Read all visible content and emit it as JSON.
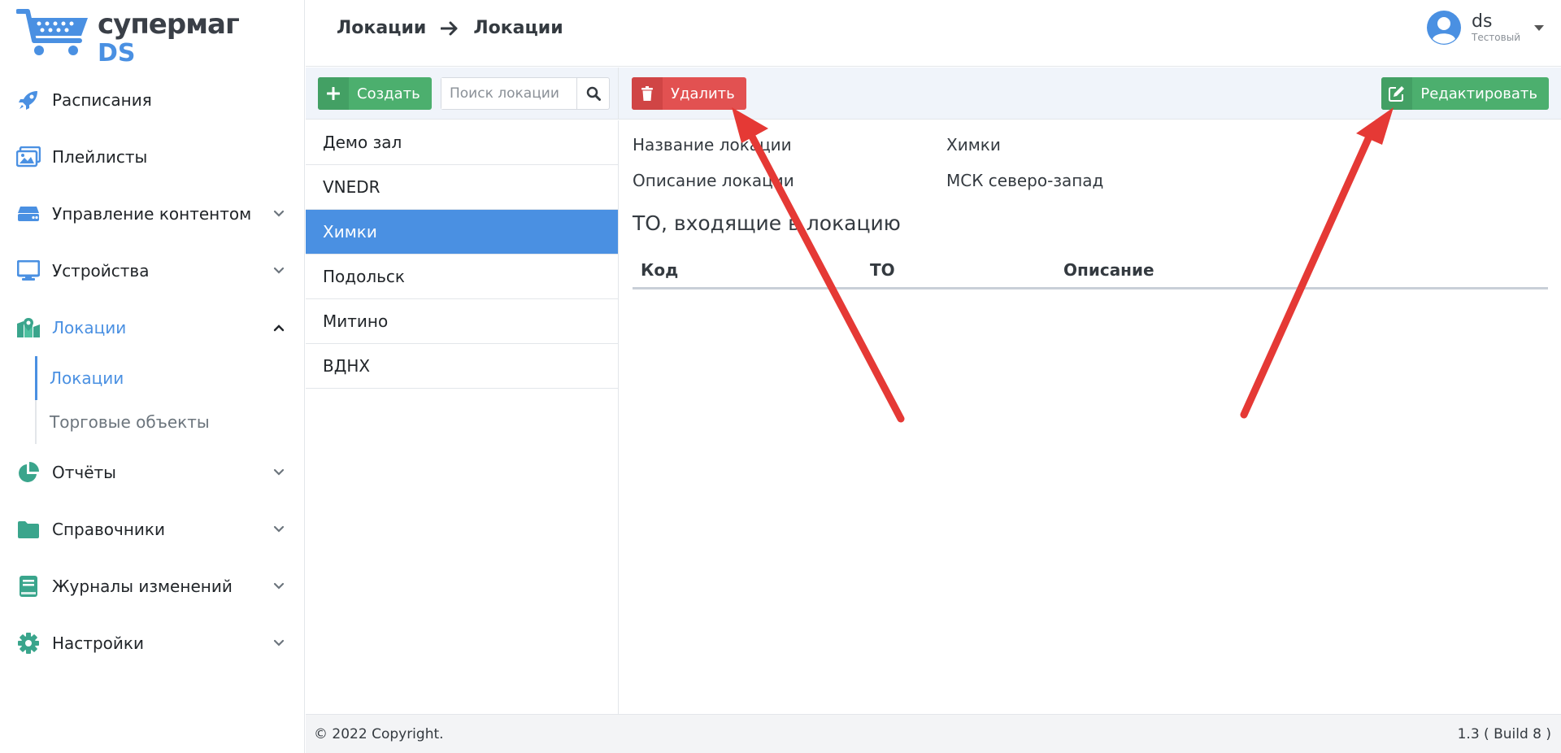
{
  "brand": {
    "line1": "супермаг",
    "line2": "DS"
  },
  "sidebar": {
    "items": [
      {
        "label": "Расписания",
        "icon": "rocket-icon",
        "expandable": false
      },
      {
        "label": "Плейлисты",
        "icon": "images-icon",
        "expandable": false
      },
      {
        "label": "Управление контентом",
        "icon": "server-icon",
        "expandable": true
      },
      {
        "label": "Устройства",
        "icon": "monitor-icon",
        "expandable": true
      },
      {
        "label": "Локации",
        "icon": "map-marker-icon",
        "expandable": true,
        "expanded": true
      },
      {
        "label": "Отчёты",
        "icon": "pie-chart-icon",
        "expandable": true
      },
      {
        "label": "Справочники",
        "icon": "folder-icon",
        "expandable": true
      },
      {
        "label": "Журналы изменений",
        "icon": "book-icon",
        "expandable": true
      },
      {
        "label": "Настройки",
        "icon": "gear-icon",
        "expandable": true
      }
    ],
    "subitems": [
      {
        "label": "Локации",
        "active": true
      },
      {
        "label": "Торговые объекты",
        "active": false
      }
    ]
  },
  "header": {
    "breadcrumb": [
      "Локации",
      "Локации"
    ],
    "user": {
      "name": "ds",
      "role": "Тестовый"
    }
  },
  "toolbar": {
    "create_label": "Создать",
    "search_placeholder": "Поиск локации",
    "delete_label": "Удалить",
    "edit_label": "Редактировать"
  },
  "locations": [
    "Демо зал",
    "VNEDR",
    "Химки",
    "Подольск",
    "Митино",
    "ВДНХ"
  ],
  "selected_location": "Химки",
  "detail": {
    "name_label": "Название локации",
    "name_value": "Химки",
    "desc_label": "Описание локации",
    "desc_value": "МСК северо-запад",
    "section_title": "ТО, входящие в локацию",
    "columns": [
      "Код",
      "ТО",
      "Описание"
    ]
  },
  "footer": {
    "copyright": "© 2022 Copyright.",
    "version": "1.3 ( Build 8 )"
  },
  "colors": {
    "accent": "#4a90e2",
    "green": "#4caf6e",
    "red": "#e25151",
    "icon_teal": "#3aa58c",
    "arrow": "#e53935"
  }
}
